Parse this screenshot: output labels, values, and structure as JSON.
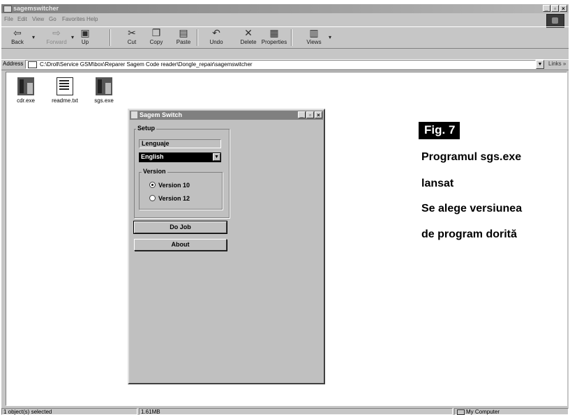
{
  "window": {
    "title": "sagemswitcher"
  },
  "menu": [
    "File",
    "Edit",
    "View",
    "Go",
    "Favorites",
    "Help"
  ],
  "toolbar": [
    {
      "label": "Back",
      "icon": "back-arrow-icon",
      "glyph": "⇦",
      "enabled": true
    },
    {
      "label": "Forward",
      "icon": "forward-arrow-icon",
      "glyph": "⇨",
      "enabled": false
    },
    {
      "label": "Up",
      "icon": "folder-up-icon",
      "glyph": "▣",
      "enabled": true
    },
    {
      "label": "Cut",
      "icon": "scissors-icon",
      "glyph": "✂",
      "enabled": true
    },
    {
      "label": "Copy",
      "icon": "copy-icon",
      "glyph": "❐",
      "enabled": true
    },
    {
      "label": "Paste",
      "icon": "paste-icon",
      "glyph": "▤",
      "enabled": true
    },
    {
      "label": "Undo",
      "icon": "undo-icon",
      "glyph": "↶",
      "enabled": true
    },
    {
      "label": "Delete",
      "icon": "delete-x-icon",
      "glyph": "✕",
      "enabled": true
    },
    {
      "label": "Properties",
      "icon": "properties-icon",
      "glyph": "▦",
      "enabled": true
    },
    {
      "label": "Views",
      "icon": "views-icon",
      "glyph": "▥",
      "enabled": true
    }
  ],
  "address": {
    "label": "Address",
    "path": "C:\\Droll\\Service GSM\\box\\Reparer Sagem Code reader\\Dongle_repair\\sagemswitcher",
    "links": "Links »"
  },
  "files": [
    {
      "name": "cdr.exe",
      "type": "exe"
    },
    {
      "name": "readme.txt",
      "type": "txt"
    },
    {
      "name": "sgs.exe",
      "type": "exe"
    }
  ],
  "dialog": {
    "title": "Sagem Switch",
    "setup_label": "Setup",
    "language_label": "Lenguaje",
    "language_value": "English",
    "version_label": "Version",
    "options": [
      {
        "label": "Version 10",
        "selected": true
      },
      {
        "label": "Version 12",
        "selected": false
      }
    ],
    "do_job": "Do Job",
    "about": "About"
  },
  "status": {
    "left": "1 object(s) selected",
    "size": "1.61MB",
    "zone": "My Computer"
  },
  "annotation": {
    "fig": "Fig. 7",
    "lines": [
      "Programul sgs.exe",
      "lansat",
      "Se alege versiunea",
      "de program dorită"
    ]
  }
}
